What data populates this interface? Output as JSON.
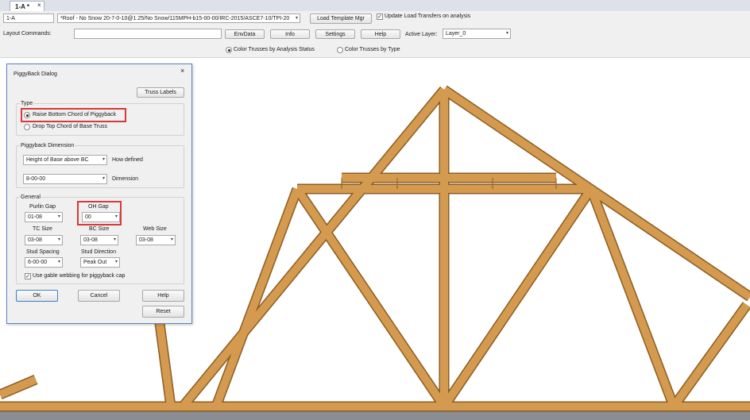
{
  "tab": {
    "label": "1-A *",
    "close": "×"
  },
  "toolbar": {
    "truss_name": "1-A",
    "load_template": "*Roof - No Snow 20-7-0-10@1.25/No Snow/115MPH-b15-00-00/IRC-2015/ASCE7-10/TPI-20",
    "load_template_btn": "Load Template Mgr",
    "update_load_label": "Update Load Transfers on analysis",
    "layout_commands_label": "Layout Commands:",
    "envdata": "EnvData",
    "info": "Info",
    "settings": "Settings",
    "help": "Help",
    "active_layer_label": "Active Layer:",
    "active_layer": "Layer_0",
    "color_status": "Color Trusses by Analysis Status",
    "color_type": "Color Trusses by Type"
  },
  "dialog": {
    "title": "PiggyBack Dialog",
    "close": "×",
    "truss_labels": "Truss Labels",
    "type_label": "Type",
    "type_opt1": "Raise Bottom Chord of Piggyback",
    "type_opt2": "Drop Top Chord of Base Truss",
    "dim_label": "Piggyback Dimension",
    "how_value": "Height of Base above BC",
    "how_label": "How defined",
    "dim_value": "8-00-00",
    "dim_field_label": "Dimension",
    "general_label": "General",
    "purlin_label": "Purlin Gap",
    "purlin_value": "01-08",
    "oh_label": "OH Gap",
    "oh_value": "00",
    "tc_label": "TC Size",
    "tc_value": "03-08",
    "bc_label": "BC Size",
    "bc_value": "03-08",
    "web_label": "Web Size",
    "web_value": "03-08",
    "spacing_label": "Stud Spacing",
    "spacing_value": "6-00-00",
    "direction_label": "Stud Direction",
    "direction_value": "Peak Out",
    "gable_label": "Use gable webbing for piggyback cap",
    "ok": "OK",
    "cancel": "Cancel",
    "help": "Help",
    "reset": "Reset"
  },
  "colors": {
    "wood": "#d39a50",
    "wood_edge": "#8c5d22",
    "highlight": "#d9393a"
  }
}
